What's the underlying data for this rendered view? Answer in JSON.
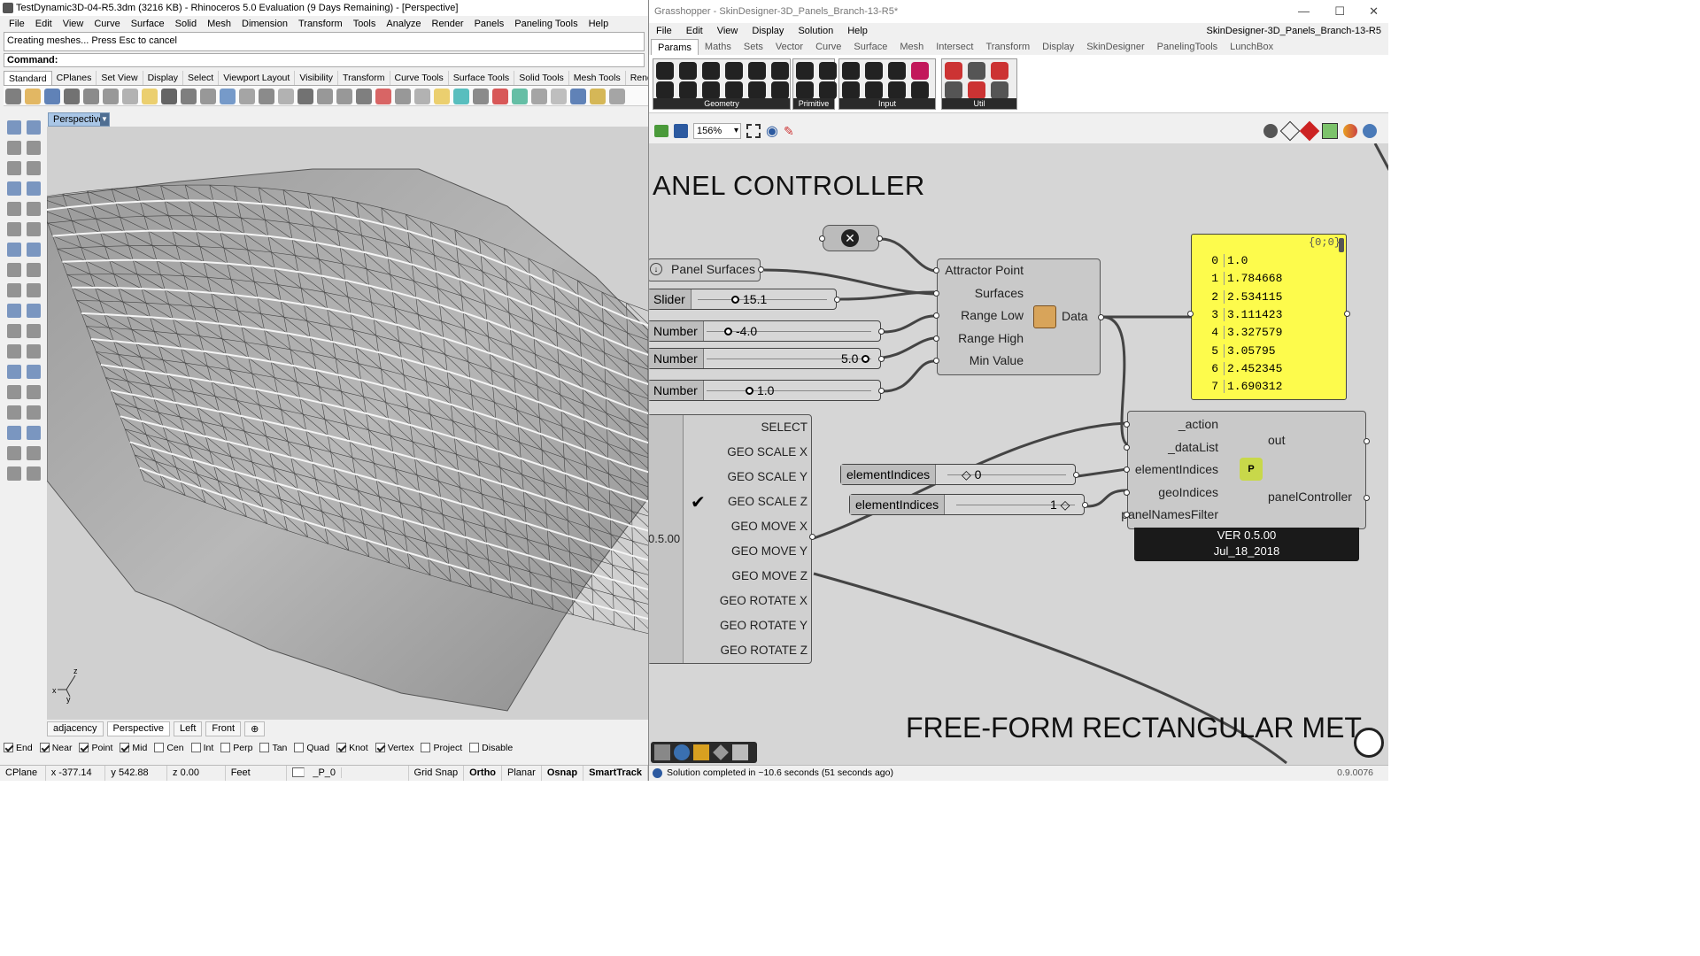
{
  "rhino": {
    "title": "TestDynamic3D-04-R5.3dm (3216 KB) - Rhinoceros 5.0 Evaluation (9 Days Remaining) - [Perspective]",
    "menu": [
      "File",
      "Edit",
      "View",
      "Curve",
      "Surface",
      "Solid",
      "Mesh",
      "Dimension",
      "Transform",
      "Tools",
      "Analyze",
      "Render",
      "Panels",
      "Paneling Tools",
      "Help"
    ],
    "command_history": "Creating meshes... Press Esc to cancel",
    "command_label": "Command:",
    "toolbar_tabs": [
      "Standard",
      "CPlanes",
      "Set View",
      "Display",
      "Select",
      "Viewport Layout",
      "Visibility",
      "Transform",
      "Curve Tools",
      "Surface Tools",
      "Solid Tools",
      "Mesh Tools",
      "Render Tools"
    ],
    "active_toolbar_tab": "Standard",
    "viewport_label": "Perspective",
    "viewport_tabs": [
      "adjacency",
      "Perspective",
      "Left",
      "Front",
      "⊕"
    ],
    "osnaps": [
      {
        "label": "End",
        "checked": true
      },
      {
        "label": "Near",
        "checked": true
      },
      {
        "label": "Point",
        "checked": true
      },
      {
        "label": "Mid",
        "checked": true
      },
      {
        "label": "Cen",
        "checked": false
      },
      {
        "label": "Int",
        "checked": false
      },
      {
        "label": "Perp",
        "checked": false
      },
      {
        "label": "Tan",
        "checked": false
      },
      {
        "label": "Quad",
        "checked": false
      },
      {
        "label": "Knot",
        "checked": true
      },
      {
        "label": "Vertex",
        "checked": true
      },
      {
        "label": "Project",
        "checked": false
      },
      {
        "label": "Disable",
        "checked": false
      }
    ],
    "status": {
      "cplane": "CPlane",
      "x": "x -377.14",
      "y": "y 542.88",
      "z": "z 0.00",
      "units": "Feet",
      "layer": "_P_0",
      "grid_snap": "Grid Snap",
      "ortho": "Ortho",
      "planar": "Planar",
      "osnap": "Osnap",
      "smarttrack": "SmartTrack"
    },
    "axis": {
      "x": "x",
      "y": "y",
      "z": "z"
    }
  },
  "gh": {
    "title": "Grasshopper - SkinDesigner-3D_Panels_Branch-13-R5*",
    "file_label": "SkinDesigner-3D_Panels_Branch-13-R5",
    "menu": [
      "File",
      "Edit",
      "View",
      "Display",
      "Solution",
      "Help"
    ],
    "tabs": [
      "Params",
      "Maths",
      "Sets",
      "Vector",
      "Curve",
      "Surface",
      "Mesh",
      "Intersect",
      "Transform",
      "Display",
      "SkinDesigner",
      "PanelingTools",
      "LunchBox"
    ],
    "active_tab": "Params",
    "groups": [
      "Geometry",
      "Primitive",
      "Input",
      "Util"
    ],
    "zoom": "156%",
    "canvas": {
      "header1": "ANEL CONTROLLER",
      "header2": "FREE-FORM RECTANGULAR MET",
      "panel_surfaces": "Panel Surfaces",
      "slider": {
        "tag": "Slider",
        "value": "15.1"
      },
      "numbers": [
        {
          "tag": "Number",
          "value": "-4.0"
        },
        {
          "tag": "Number",
          "value": "5.0"
        },
        {
          "tag": "Number",
          "value": "1.0"
        }
      ],
      "component": {
        "inputs": [
          "Attractor Point",
          "Surfaces",
          "Range Low",
          "Range High",
          "Min Value"
        ],
        "output": "Data"
      },
      "panel": {
        "path": "{0;0}",
        "rows": [
          {
            "i": "0",
            "v": "1.0"
          },
          {
            "i": "1",
            "v": "1.784668"
          },
          {
            "i": "2",
            "v": "2.534115"
          },
          {
            "i": "3",
            "v": "3.111423"
          },
          {
            "i": "4",
            "v": "3.327579"
          },
          {
            "i": "5",
            "v": "3.05795"
          },
          {
            "i": "6",
            "v": "2.452345"
          },
          {
            "i": "7",
            "v": "1.690312"
          }
        ]
      },
      "value_list": {
        "items": [
          "SELECT",
          "GEO SCALE X",
          "GEO SCALE Y",
          "GEO SCALE Z",
          "GEO MOVE X",
          "GEO MOVE Y",
          "GEO MOVE Z",
          "GEO ROTATE X",
          "GEO ROTATE Y",
          "GEO ROTATE Z"
        ],
        "checked_index": 3,
        "side_value": "0.5.00"
      },
      "element_indices": [
        {
          "tag": "elementIndices",
          "value": "0"
        },
        {
          "tag": "elementIndices",
          "value": "1"
        }
      ],
      "panel_controller": {
        "inputs": [
          "_action",
          "_dataList",
          "elementIndices",
          "geoIndices",
          "panelNamesFilter"
        ],
        "out1": "out",
        "out2": "panelController",
        "version": "VER 0.5.00",
        "date": "Jul_18_2018"
      }
    },
    "status": "Solution completed in ~10.6 seconds (51 seconds ago)",
    "version": "0.9.0076"
  }
}
